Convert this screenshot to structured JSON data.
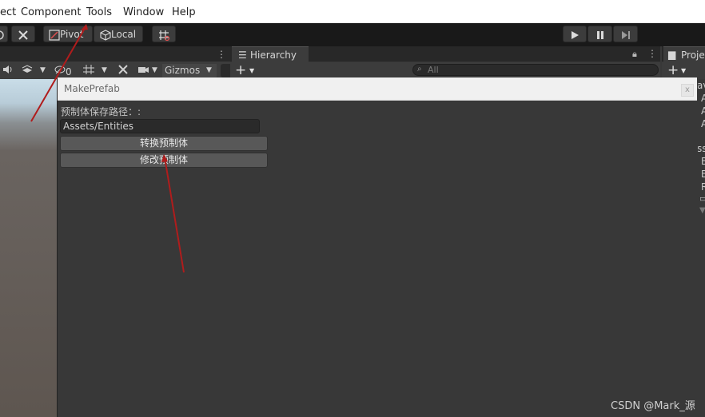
{
  "menu": {
    "items": [
      "ect",
      "Component",
      "Tools",
      "Window",
      "Help"
    ]
  },
  "toolbar": {
    "pivot_label": "Pivot",
    "local_label": "Local"
  },
  "scene_toolbar": {
    "visibility_count": "0",
    "gizmos_label": "Gizmos"
  },
  "hierarchy": {
    "tab_label": "Hierarchy",
    "search_placeholder": "All"
  },
  "project": {
    "tab_label": "Proje",
    "side_letters": [
      "av",
      "A",
      "A",
      "A",
      "ss",
      "B",
      "B",
      "R"
    ]
  },
  "dialog": {
    "title": "MakePrefab",
    "close_label": "x",
    "path_label": "预制体保存路径：:",
    "path_value": "Assets/Entities",
    "convert_button": "转换预制体",
    "modify_button": "修改预制体"
  },
  "watermark": "CSDN @Mark_源",
  "colors": {
    "annotation_arrow": "#b01c1c",
    "panel_bg": "#383838",
    "toolbar_bg": "#191919"
  }
}
